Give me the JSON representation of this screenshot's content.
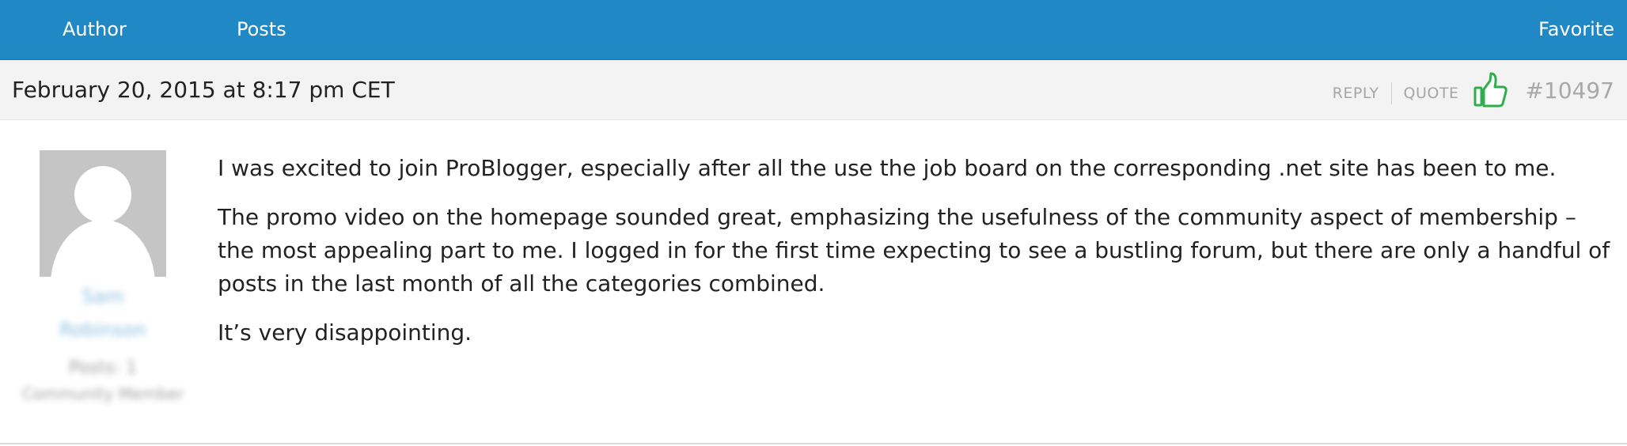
{
  "header": {
    "author_label": "Author",
    "posts_label": "Posts",
    "favorite_label": "Favorite",
    "background_color": "#2188c6"
  },
  "post": {
    "date": "February 20, 2015 at 8:17 pm CET",
    "actions": {
      "reply_label": "REPLY",
      "quote_label": "QUOTE",
      "like_icon": "thumbs-up-icon",
      "like_color": "#2fae4b"
    },
    "id_label": "#10497",
    "paragraphs": [
      "I was excited to join ProBlogger, especially after all the use the job board on the corresponding .net site has been to me.",
      "The promo video on the homepage sounded great, emphasizing the usefulness of the community aspect of membership – the most appealing part to me. I logged in for the first time expecting to see a bustling forum, but there are only a handful of posts in the last month of all the categories combined.",
      "It’s very disappointing."
    ]
  },
  "author": {
    "avatar_icon": "default-avatar-icon",
    "first_name": "Sam",
    "last_name": "Robinson",
    "posts_count": "Posts: 1",
    "role": "Community Member",
    "link_color": "#2d8ac6"
  }
}
